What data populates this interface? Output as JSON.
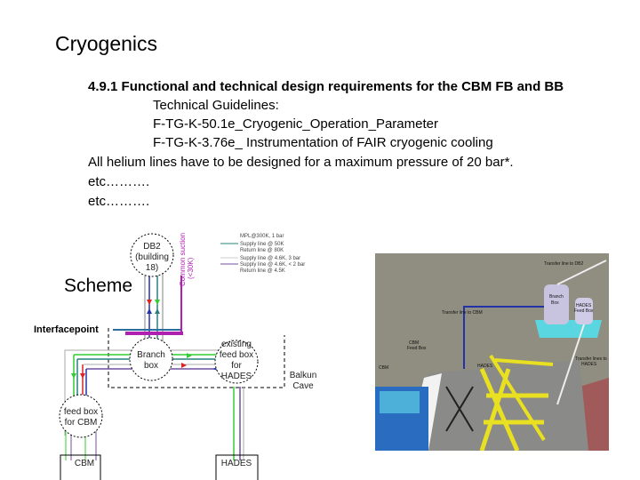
{
  "title": "Cryogenics",
  "body": {
    "heading": "4.9.1 Functional and technical design requirements for the CBM FB and BB",
    "guidelines_label": "Technical Guidelines:",
    "guideline_1": "F-TG-K-50.1e_Cryogenic_Operation_Parameter",
    "guideline_2": "F-TG-K-3.76e_ Instrumentation of FAIR cryogenic cooling",
    "requirement": "All helium lines have to be designed for a maximum pressure of 20 bar*.",
    "etc_1": "etc……….",
    "etc_2": "etc………."
  },
  "scheme": {
    "label": "Scheme",
    "interface_label": "Interfacepoint",
    "db2": [
      "DB2",
      "(building",
      "18)"
    ],
    "branch": [
      "Branch",
      "box"
    ],
    "hades_fb": [
      "existing",
      "feed box",
      "for",
      "HADES"
    ],
    "cbm_fb": [
      "feed box",
      "for CBM"
    ],
    "cave": [
      "Balkun",
      "Cave"
    ],
    "cbm": "CBM",
    "hades": "HADES",
    "suction": [
      "Common suction",
      "(<30K)"
    ],
    "legend": [
      "MPL@300K, 1 bar",
      "Supply line @ 50K",
      "Return line @ 80K",
      "Supply line @ 4.6K, 3 bar",
      "Supply line @ 4.6K, < 2 bar",
      "Return line @ 4.5K"
    ],
    "colors": {
      "green": "#3c3",
      "teal": "#2a8080",
      "blue": "#2233aa",
      "red": "#d22",
      "purple": "#7050a0",
      "magenta": "#b020b0",
      "grey": "#aaa"
    }
  },
  "render": {
    "transfer_db2": "Transfer line to DB2",
    "branch_box": [
      "Branch",
      "Box"
    ],
    "hades_fb": [
      "HADES",
      "Feed Box"
    ],
    "transfer_cbm": "Transfer line to CBM",
    "cbm_fb": [
      "CBM",
      "Feed Box"
    ],
    "cbm": "CBM",
    "hades": "HADES",
    "transfer_hades": [
      "Transfer lines to",
      "HADES"
    ]
  }
}
